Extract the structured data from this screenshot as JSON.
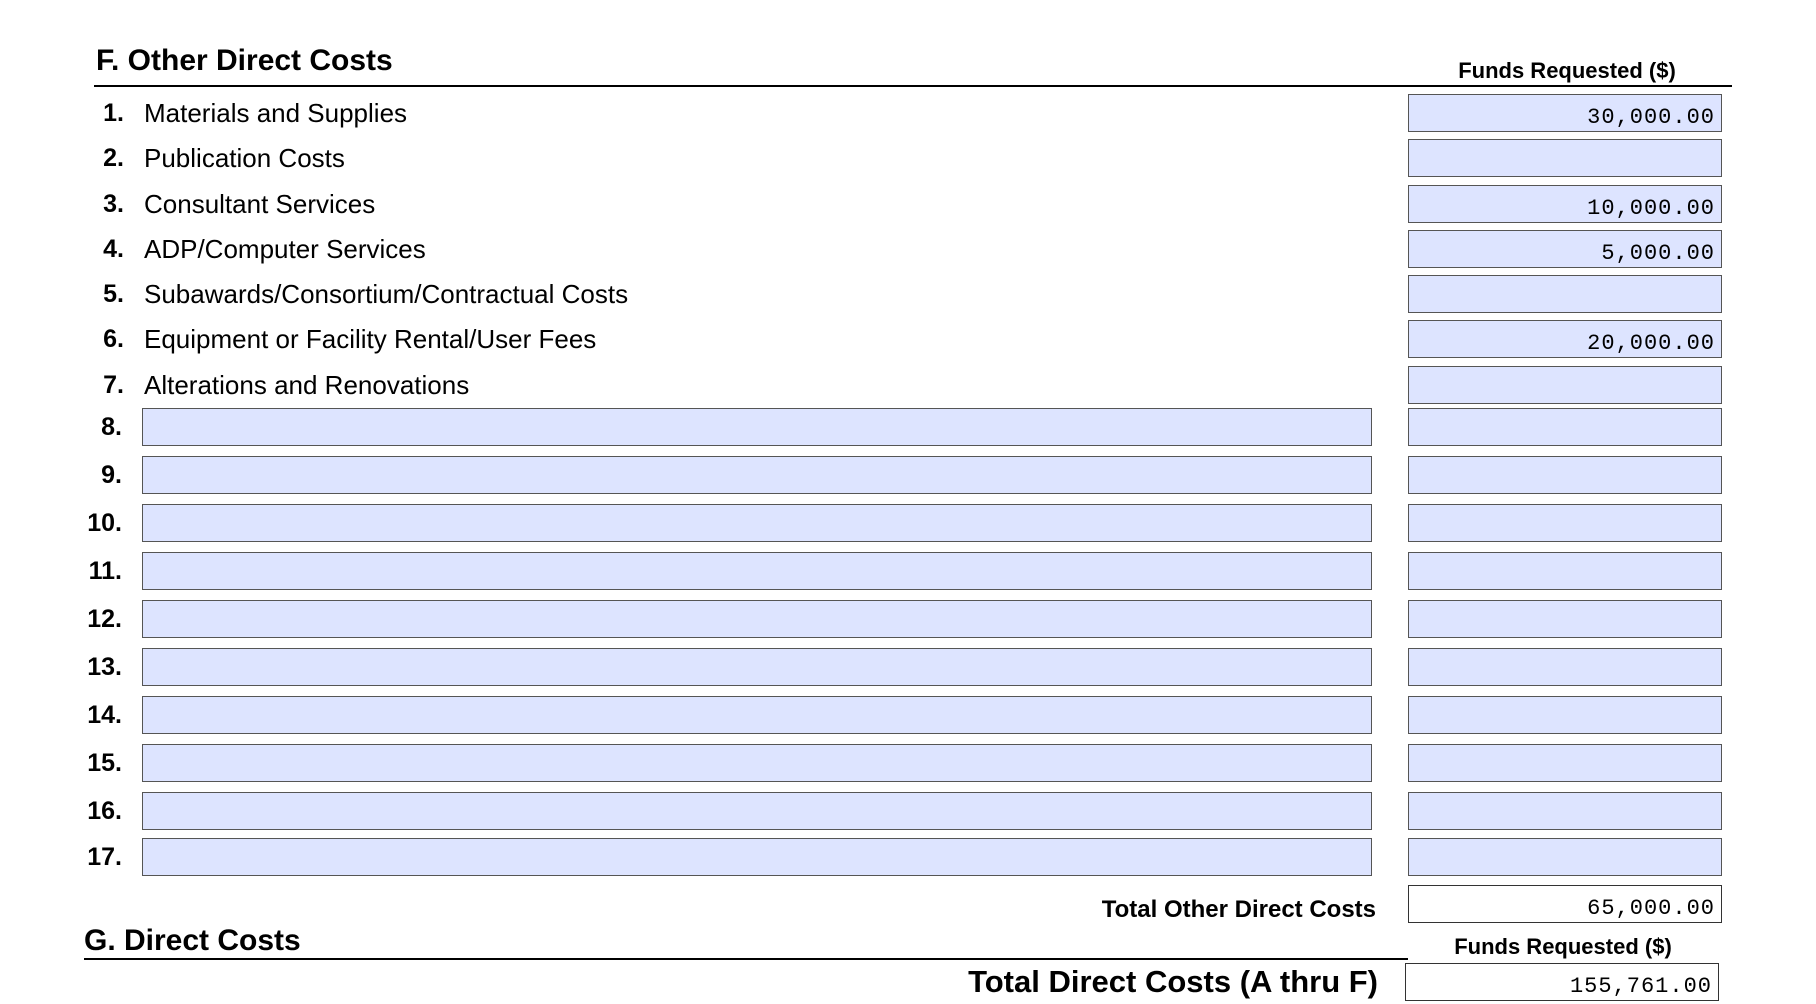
{
  "section_f": {
    "title": "F. Other Direct Costs",
    "funds_header": "Funds Requested ($)",
    "items": [
      {
        "num": "1.",
        "label": "Materials and Supplies",
        "amount": "30,000.00"
      },
      {
        "num": "2.",
        "label": "Publication Costs",
        "amount": ""
      },
      {
        "num": "3.",
        "label": "Consultant Services",
        "amount": "10,000.00"
      },
      {
        "num": "4.",
        "label": "ADP/Computer Services",
        "amount": "5,000.00"
      },
      {
        "num": "5.",
        "label": "Subawards/Consortium/Contractual Costs",
        "amount": ""
      },
      {
        "num": "6.",
        "label": "Equipment or Facility Rental/User Fees",
        "amount": "20,000.00"
      },
      {
        "num": "7.",
        "label": "Alterations and Renovations",
        "amount": ""
      }
    ],
    "custom_items": [
      {
        "num": "8.",
        "description": "",
        "amount": ""
      },
      {
        "num": "9.",
        "description": "",
        "amount": ""
      },
      {
        "num": "10.",
        "description": "",
        "amount": ""
      },
      {
        "num": "11.",
        "description": "",
        "amount": ""
      },
      {
        "num": "12.",
        "description": "",
        "amount": ""
      },
      {
        "num": "13.",
        "description": "",
        "amount": ""
      },
      {
        "num": "14.",
        "description": "",
        "amount": ""
      },
      {
        "num": "15.",
        "description": "",
        "amount": ""
      },
      {
        "num": "16.",
        "description": "",
        "amount": ""
      },
      {
        "num": "17.",
        "description": "",
        "amount": ""
      }
    ],
    "total_label": "Total Other Direct Costs",
    "total_value": "65,000.00"
  },
  "section_g": {
    "title": "G. Direct Costs",
    "funds_header": "Funds Requested ($)",
    "total_label": "Total Direct Costs (A thru F)",
    "total_value": "155,761.00"
  },
  "colors": {
    "field_fill": "#dde4ff",
    "field_border": "#555555"
  }
}
